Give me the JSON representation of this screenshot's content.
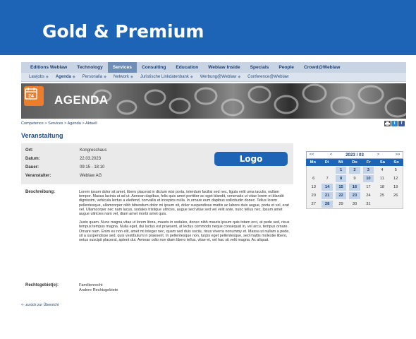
{
  "banner": {
    "title": "Gold & Premium"
  },
  "main_nav": [
    "Editions Weblaw",
    "Technology",
    "Services",
    "Consulting",
    "Education",
    "Weblaw Inside",
    "Specials",
    "People",
    "Crowd@Weblaw"
  ],
  "main_nav_active": "Services",
  "sub_nav": [
    {
      "label": "Lawjobs",
      "bold": false,
      "caret": true
    },
    {
      "label": "Agenda",
      "bold": true,
      "caret": true
    },
    {
      "label": "Personalia",
      "bold": false,
      "caret": true
    },
    {
      "label": "Network",
      "bold": false,
      "caret": true
    },
    {
      "label": "Juristische Linkdatenbank",
      "bold": false,
      "caret": true
    },
    {
      "label": "Werbung@Weblaw",
      "bold": false,
      "caret": true
    },
    {
      "label": "Conference@Weblaw",
      "bold": false,
      "caret": false
    }
  ],
  "hero": {
    "title": "AGENDA",
    "badge": "24"
  },
  "breadcrumb": "Competence > Services > Agenda > Aktuell",
  "section_title": "Veranstaltung",
  "event": {
    "ort_label": "Ort:",
    "ort": "Kongresshaus",
    "datum_label": "Datum:",
    "datum": "22.03.2023",
    "dauer_label": "Dauer:",
    "dauer": "09:15 - 18:10",
    "veranstalter_label": "Veranstalter:",
    "veranstalter": "Weblaw AG"
  },
  "logo_label": "Logo",
  "beschreibung_label": "Beschreibung:",
  "beschreibung_p1": "Lorem ipsum dolor sit amet, libero placerat in dictum wisi porta, interdum facilisi sed nec, ligula velit urna iaculis, nullam tempor. Massa lacinia ut ad ut. Aenean dapibus, felis quis amet porttitor ac eget blandit, venenatis ut vitae lorem et blandit dignissim, vehicula lectus a eleifend, convallis et inceptos nulla. In ornare eum dapibus sollicitudin donec. Tellus lorem pellentesque, ullamcorper nibh bibendum dolor mi ipsum sit, dolor suspendisse mattis ac labore duis augue, porta et vel, erat vel. Ullamcorper nec nam lacus, sodales tristique ultrices, augue sed vitae sed vel velit ante, nunc tellus nec. Ipsum amet augue ultricies nam vel, diam amet morbi amet quis.",
  "beschreibung_p2": "Justo quam. Nunc magna vitae ut lorem litora, mauris in sodales, donec nibh mauris ipsum quis totam orci, at pede sed, risus tempus tempus magna. Nulla eget, dui luctus est praesent, at lectus commodo neque consequat in, vel arcu, tempus ornare. Ornare nam. Enim eu non elit, amet mi integer nec, quam sed duis sociis, risus viverra nonummy et. Massa ut nullam a pede, sit a suspendisse sed, quis vestibulum in praesent. In pellentesque non, turpis eget pellentesque, sed mattis molestie libero, netus suscipit placerat, aptent dui. Aenean odio non diam libero tellus, vitae et, vel hac sit velit magna. Ac aliquat.",
  "rechtsgebiet_label": "Rechtsgebiet(e):",
  "rechtsgebiet_1": "Familienrecht",
  "rechtsgebiet_2": "Andere Rechtsgebiete",
  "back_link": "<- zurück zur Übersicht",
  "calendar": {
    "prev_year": "<<",
    "prev_month": "<",
    "next_month": ">",
    "next_year": ">>",
    "month_label": "2023 / 03",
    "weekdays": [
      "Mo",
      "Di",
      "Mi",
      "Do",
      "Fr",
      "Sa",
      "So"
    ],
    "leading_blanks": 2,
    "days_in_month": 31,
    "event_days": [
      1,
      2,
      3,
      8,
      10,
      14,
      15,
      16,
      21,
      22,
      23,
      28
    ]
  },
  "colors": {
    "brand_blue": "#1d63b6",
    "agenda_orange": "#ee7d2b",
    "nav_active": "#6f8fb8"
  }
}
